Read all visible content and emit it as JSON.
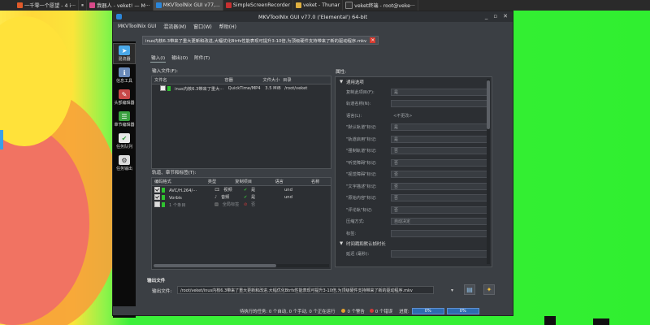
{
  "taskbar": {
    "items": [
      {
        "label": "一千零一个愿望 - 4 i···",
        "icon_color": "#e05a2a"
      },
      {
        "label": "⏸",
        "icon_color": "#666666"
      },
      {
        "label": "我器人 - veket! — M···",
        "icon_color": "#d84a8a"
      },
      {
        "label": "MKVToolNix GUI v77,...",
        "icon_color": "#2b86d9",
        "active": true
      },
      {
        "label": "SimpleScreenRecorder",
        "icon_color": "#c83030"
      },
      {
        "label": "veket - Thunar",
        "icon_color": "#e0b040"
      },
      {
        "label": "veket终端 - root@veke···",
        "icon_color": "#333333"
      }
    ]
  },
  "window": {
    "title": "MKVToolNix GUI v77.0 ('Elemental') 64-bit",
    "buttons": [
      "_",
      "▫",
      "✕"
    ]
  },
  "menu": [
    "MKVToolNix GUI",
    "混流器(M)",
    "窗口(W)",
    "帮助(H)"
  ],
  "sidebar": [
    {
      "label": "混流器",
      "icon": "merge-icon",
      "color": "#4aa8e8",
      "active": true
    },
    {
      "label": "信息工具",
      "icon": "info-icon",
      "color": "#6a8ab8"
    },
    {
      "label": "头部编辑器",
      "icon": "header-editor-icon",
      "color": "#c84848"
    },
    {
      "label": "章节编辑器",
      "icon": "chapter-editor-icon",
      "color": "#3aa040"
    },
    {
      "label": "任务队列",
      "icon": "job-queue-icon",
      "color": "#3aa040"
    },
    {
      "label": "任务输出",
      "icon": "job-output-icon",
      "color": "#dcdcdc"
    }
  ],
  "doc_tab": {
    "label": "inus内核6.3带来了重大更新和改进,大幅优化Btrfs性能表现可提升3-10倍,为顶级硬件支持带来了新的驱动程序.mkv"
  },
  "subtabs": [
    "输入(I)",
    "输出(O)",
    "附件(T)"
  ],
  "input_files": {
    "label": "输入文件(F):",
    "columns": [
      "文件名",
      "容器",
      "文件大小",
      "目录"
    ],
    "rows": [
      {
        "name": "inus内核6.3带来了重大···",
        "container": "QuickTime/MP4",
        "size": "3.5 MiB",
        "dir": "/root/veket"
      }
    ]
  },
  "tracks": {
    "label": "轨道、章节和标签(T):",
    "columns": [
      "编码格式",
      "类型",
      "复制项目",
      "语言",
      "名称"
    ],
    "rows": [
      {
        "codec": "AVC/H.264/···",
        "type": "视频",
        "copy": "是",
        "lang": "und"
      },
      {
        "codec": "Vorbis",
        "type": "音频",
        "copy": "是",
        "lang": "und"
      },
      {
        "codec": "1 个条目",
        "type": "全局标签",
        "copy": "否",
        "lang": ""
      }
    ]
  },
  "properties": {
    "label": "属性:",
    "section1": "通用选项",
    "rows": [
      {
        "label": "复制此项目(F):",
        "value": "是"
      },
      {
        "label": "轨道名称(N):",
        "value": ""
      },
      {
        "label": "语言(L):",
        "value": "<不更改>"
      },
      {
        "label": "\"默认轨道\"标记:",
        "value": "是"
      },
      {
        "label": "\"轨道启用\"标记:",
        "value": "是"
      },
      {
        "label": "\"强制轨道\"标记:",
        "value": "否"
      },
      {
        "label": "\"听觉障碍\"标记:",
        "value": "否"
      },
      {
        "label": "\"视觉障碍\"标记:",
        "value": "否"
      },
      {
        "label": "\"文字描述\"标记:",
        "value": "否"
      },
      {
        "label": "\"原始内容\"标记:",
        "value": "否"
      },
      {
        "label": "\"评论轨\"标记:",
        "value": "否"
      },
      {
        "label": "压缩方式:",
        "value": "自动决定"
      },
      {
        "label": "标签:",
        "value": ""
      }
    ],
    "section2": "时间戳和默认帧时长",
    "last_row": {
      "label": "延迟 (毫秒):",
      "value": ""
    }
  },
  "output": {
    "label": "输出文件",
    "file_label": "输出文件:",
    "path": "/root/veket/inus内核6.3带来了重大更新和改进,大幅优化Btrfs性能表现可提升3-10倍,为顶级硬件支持带来了新的驱动程序.mkv"
  },
  "status": {
    "pending": "待执行的任务: 0 个自动, 0 个手动, 0 个正在运行",
    "warnings": "0 个警告",
    "errors": "0 个错误",
    "progress_label": "进度:",
    "progress1": "0%",
    "progress2": "0%"
  }
}
